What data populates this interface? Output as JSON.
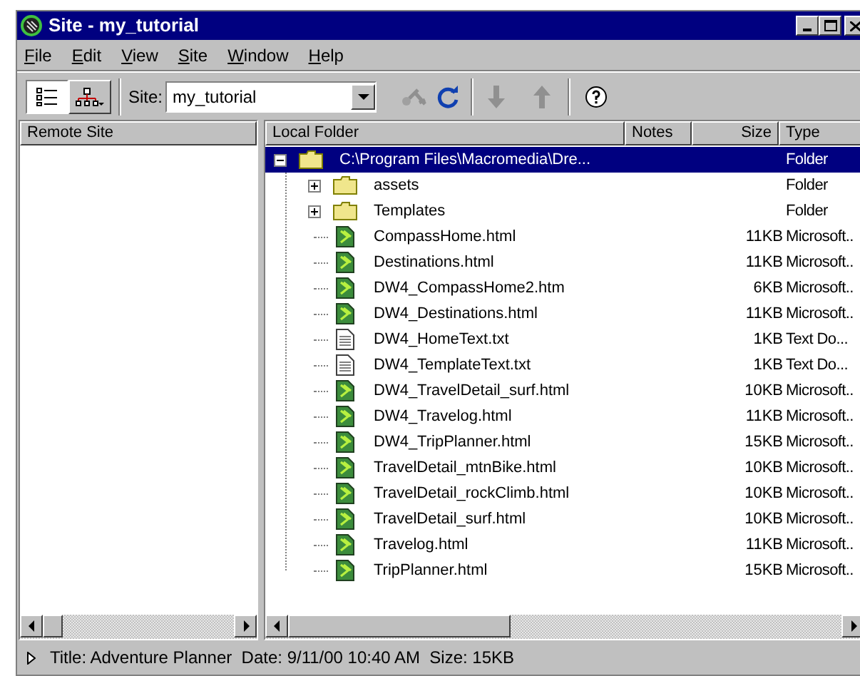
{
  "window": {
    "title": "Site - my_tutorial"
  },
  "menu": [
    "File",
    "Edit",
    "View",
    "Site",
    "Window",
    "Help"
  ],
  "toolbar": {
    "view_buttons": [
      {
        "kind": "list",
        "selected": true
      },
      {
        "kind": "map",
        "selected": false
      }
    ],
    "site_label": "Site:",
    "site_value": "my_tutorial"
  },
  "remote_pane": {
    "header": "Remote Site"
  },
  "local_pane": {
    "columns": [
      "Local Folder",
      "Notes",
      "Size",
      "Type"
    ],
    "tree": {
      "name": "C:\\Program Files\\Macromedia\\Dre...",
      "kind": "folder",
      "type": "Folder",
      "selected": true,
      "expanded": true,
      "children": [
        {
          "name": "assets",
          "kind": "folder",
          "type": "Folder",
          "selected": false,
          "expanded": false
        },
        {
          "name": "Templates",
          "kind": "folder",
          "type": "Folder",
          "selected": false,
          "expanded": false
        },
        {
          "name": "CompassHome.html",
          "kind": "html",
          "size": "11KB",
          "type": "Microsoft..",
          "selected": false
        },
        {
          "name": "Destinations.html",
          "kind": "html",
          "size": "11KB",
          "type": "Microsoft..",
          "selected": false
        },
        {
          "name": "DW4_CompassHome2.htm",
          "kind": "html",
          "size": "6KB",
          "type": "Microsoft..",
          "selected": false
        },
        {
          "name": "DW4_Destinations.html",
          "kind": "html",
          "size": "11KB",
          "type": "Microsoft..",
          "selected": false
        },
        {
          "name": "DW4_HomeText.txt",
          "kind": "text",
          "size": "1KB",
          "type": "Text Do...",
          "selected": false
        },
        {
          "name": "DW4_TemplateText.txt",
          "kind": "text",
          "size": "1KB",
          "type": "Text Do...",
          "selected": false
        },
        {
          "name": "DW4_TravelDetail_surf.html",
          "kind": "html",
          "size": "10KB",
          "type": "Microsoft..",
          "selected": false
        },
        {
          "name": "DW4_Travelog.html",
          "kind": "html",
          "size": "11KB",
          "type": "Microsoft..",
          "selected": false
        },
        {
          "name": "DW4_TripPlanner.html",
          "kind": "html",
          "size": "15KB",
          "type": "Microsoft..",
          "selected": false
        },
        {
          "name": "TravelDetail_mtnBike.html",
          "kind": "html",
          "size": "10KB",
          "type": "Microsoft..",
          "selected": false
        },
        {
          "name": "TravelDetail_rockClimb.html",
          "kind": "html",
          "size": "10KB",
          "type": "Microsoft..",
          "selected": false
        },
        {
          "name": "TravelDetail_surf.html",
          "kind": "html",
          "size": "10KB",
          "type": "Microsoft..",
          "selected": false
        },
        {
          "name": "Travelog.html",
          "kind": "html",
          "size": "11KB",
          "type": "Microsoft..",
          "selected": false
        },
        {
          "name": "TripPlanner.html",
          "kind": "html",
          "size": "15KB",
          "type": "Microsoft..",
          "selected": false
        }
      ]
    }
  },
  "status_bar": "Title: Adventure Planner  Date: 9/11/00 10:40 AM  Size: 15KB"
}
